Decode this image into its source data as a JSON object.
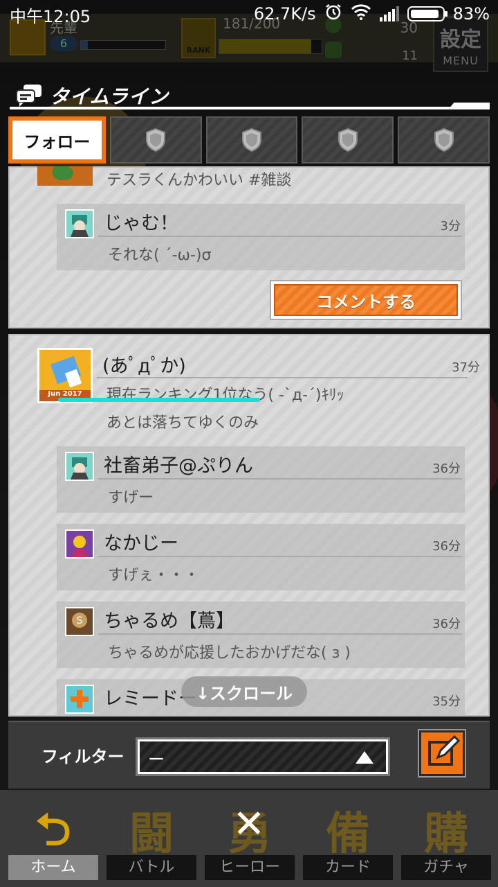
{
  "status_bar": {
    "time": "中午12:05",
    "network_speed": "62.7K/s",
    "battery": "83%"
  },
  "game_header": {
    "player_name": "先輩",
    "level": "6",
    "rank_label": "RANK",
    "stamina": "181/200",
    "currency_top": "30",
    "currency_bottom": "11",
    "settings_label": "設定",
    "menu_label": "MENU"
  },
  "timeline": {
    "title": "タイムライン",
    "tabs": [
      {
        "label": "フォロー",
        "active": true
      },
      {
        "icon": "shield-icon"
      },
      {
        "icon": "shield-icon"
      },
      {
        "icon": "shield-icon"
      },
      {
        "icon": "shield-icon"
      }
    ],
    "posts": [
      {
        "text": "テスラくんかわいい #雑談",
        "comments": [
          {
            "name": "じゃむ！",
            "time": "3分",
            "text": "それな( ´-ω-)σ"
          }
        ],
        "comment_button": "コメントする"
      },
      {
        "name": "(あﾟдﾟか)",
        "time": "37分",
        "avatar_badge": "Jun 2017",
        "text_line1": "現在ランキング1位なう( -`д-´)ｷﾘｯ",
        "text_line2": "あとは落ちてゆくのみ",
        "comments": [
          {
            "name": "社畜弟子@ぷりん",
            "time": "36分",
            "text": "すげー"
          },
          {
            "name": "なかじー",
            "time": "36分",
            "text": "すげぇ・・・"
          },
          {
            "name": "ちゃるめ【蔦】",
            "time": "36分",
            "text": "ちゃるめが応援したおかげだな( з )"
          },
          {
            "name": "レミードー",
            "time": "35分",
            "text": ""
          }
        ]
      }
    ],
    "scroll_hint": "↓スクロール"
  },
  "filter": {
    "label": "フィルター",
    "value": "ー"
  },
  "bottom_nav": [
    {
      "glyph": "⮌",
      "label": "ホーム"
    },
    {
      "glyph": "闘",
      "label": "バトル"
    },
    {
      "glyph": "勇",
      "label": "ヒーロー"
    },
    {
      "glyph": "備",
      "label": "カード"
    },
    {
      "glyph": "購",
      "label": "ガチャ"
    }
  ],
  "close_label": "✕",
  "colors": {
    "accent": "#f07414",
    "highlight": "#16e0d8"
  }
}
